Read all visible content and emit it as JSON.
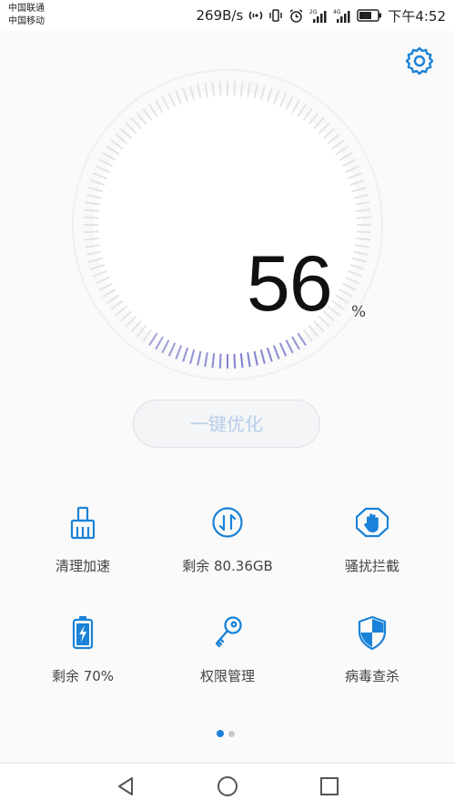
{
  "status_bar": {
    "carrier_1": "中国联通",
    "carrier_2": "中国移动",
    "network_speed": "269B/s",
    "time": "下午4:52",
    "icons": [
      "nfc-icon",
      "vibrate-icon",
      "alarm-icon",
      "signal-2g-icon",
      "signal-4g-icon",
      "battery-icon"
    ]
  },
  "main": {
    "settings_icon": "gear-icon",
    "gauge": {
      "value": "56",
      "unit": "%",
      "level": 0.56,
      "accent_color": "#7c7ccf",
      "track_color": "#e4e4e4"
    },
    "optimize_button": "一键优化"
  },
  "tiles": [
    {
      "icon": "broom-icon",
      "label": "清理加速"
    },
    {
      "icon": "storage-arrows-icon",
      "label": "剩余 80.36GB"
    },
    {
      "icon": "hand-block-icon",
      "label": "骚扰拦截"
    },
    {
      "icon": "battery-charge-icon",
      "label": "剩余 70%"
    },
    {
      "icon": "key-icon",
      "label": "权限管理"
    },
    {
      "icon": "shield-icon",
      "label": "病毒查杀"
    }
  ],
  "pagination": {
    "pages": 2,
    "active": 1
  },
  "nav_bar": {
    "buttons": [
      "back-icon",
      "home-icon",
      "recents-icon"
    ]
  },
  "colors": {
    "accent": "#1a82d8",
    "button_text": "#b7cfea"
  }
}
